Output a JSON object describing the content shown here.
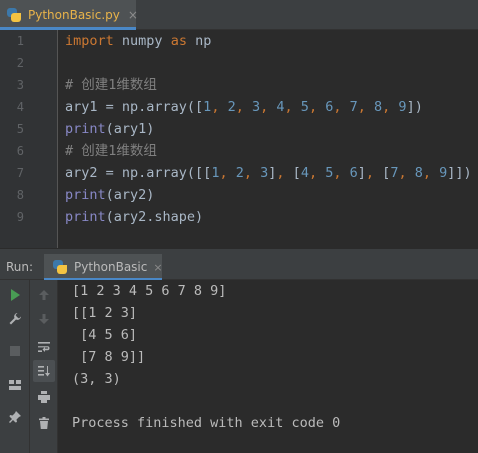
{
  "editor": {
    "tab": {
      "filename": "PythonBasic.py",
      "close": "×",
      "icon": "python-file-icon"
    },
    "line_numbers": [
      "1",
      "2",
      "3",
      "4",
      "5",
      "6",
      "7",
      "8",
      "9"
    ],
    "lines": [
      [
        {
          "t": "import",
          "c": "kw"
        },
        {
          "t": " numpy ",
          "c": "pl"
        },
        {
          "t": "as",
          "c": "kw"
        },
        {
          "t": " np",
          "c": "pl"
        }
      ],
      [],
      [
        {
          "t": "# 创建1维数组",
          "c": "cm"
        }
      ],
      [
        {
          "t": "ary1 = np.array([",
          "c": "pl"
        },
        {
          "t": "1",
          "c": "num"
        },
        {
          "t": ", ",
          "c": "kw"
        },
        {
          "t": "2",
          "c": "num"
        },
        {
          "t": ", ",
          "c": "kw"
        },
        {
          "t": "3",
          "c": "num"
        },
        {
          "t": ", ",
          "c": "kw"
        },
        {
          "t": "4",
          "c": "num"
        },
        {
          "t": ", ",
          "c": "kw"
        },
        {
          "t": "5",
          "c": "num"
        },
        {
          "t": ", ",
          "c": "kw"
        },
        {
          "t": "6",
          "c": "num"
        },
        {
          "t": ", ",
          "c": "kw"
        },
        {
          "t": "7",
          "c": "num"
        },
        {
          "t": ", ",
          "c": "kw"
        },
        {
          "t": "8",
          "c": "num"
        },
        {
          "t": ", ",
          "c": "kw"
        },
        {
          "t": "9",
          "c": "num"
        },
        {
          "t": "])",
          "c": "pl"
        }
      ],
      [
        {
          "t": "print",
          "c": "fn"
        },
        {
          "t": "(ary1)",
          "c": "pl"
        }
      ],
      [
        {
          "t": "# 创建1维数组",
          "c": "cm"
        }
      ],
      [
        {
          "t": "ary2 = np.array([[",
          "c": "pl"
        },
        {
          "t": "1",
          "c": "num"
        },
        {
          "t": ", ",
          "c": "kw"
        },
        {
          "t": "2",
          "c": "num"
        },
        {
          "t": ", ",
          "c": "kw"
        },
        {
          "t": "3",
          "c": "num"
        },
        {
          "t": "]",
          "c": "pl"
        },
        {
          "t": ", ",
          "c": "kw"
        },
        {
          "t": "[",
          "c": "pl"
        },
        {
          "t": "4",
          "c": "num"
        },
        {
          "t": ", ",
          "c": "kw"
        },
        {
          "t": "5",
          "c": "num"
        },
        {
          "t": ", ",
          "c": "kw"
        },
        {
          "t": "6",
          "c": "num"
        },
        {
          "t": "]",
          "c": "pl"
        },
        {
          "t": ", ",
          "c": "kw"
        },
        {
          "t": "[",
          "c": "pl"
        },
        {
          "t": "7",
          "c": "num"
        },
        {
          "t": ", ",
          "c": "kw"
        },
        {
          "t": "8",
          "c": "num"
        },
        {
          "t": ", ",
          "c": "kw"
        },
        {
          "t": "9",
          "c": "num"
        },
        {
          "t": "]])",
          "c": "pl"
        }
      ],
      [
        {
          "t": "print",
          "c": "fn"
        },
        {
          "t": "(ary2)",
          "c": "pl"
        }
      ],
      [
        {
          "t": "print",
          "c": "fn"
        },
        {
          "t": "(ary2.shape)",
          "c": "pl"
        }
      ]
    ]
  },
  "run": {
    "label": "Run:",
    "tab_name": "PythonBasic",
    "tab_close": "×",
    "toolbar_left": [
      "run-icon",
      "wrench-icon",
      "stop-icon",
      "layout-icon",
      "pin-icon"
    ],
    "toolbar_right": [
      "arrow-up-icon",
      "arrow-down-icon",
      "soft-wrap-icon",
      "scroll-to-end-icon",
      "print-icon",
      "trash-icon"
    ],
    "output": [
      "[1 2 3 4 5 6 7 8 9]",
      "[[1 2 3]",
      " [4 5 6]",
      " [7 8 9]]",
      "(3, 3)",
      "",
      "Process finished with exit code 0"
    ]
  },
  "colors": {
    "keyword": "#cc7832",
    "builtin": "#8888c6",
    "number": "#6897bb",
    "comment": "#808080",
    "plain": "#a9b7c6",
    "accent": "#4a88c7",
    "run_green": "#499c54"
  }
}
